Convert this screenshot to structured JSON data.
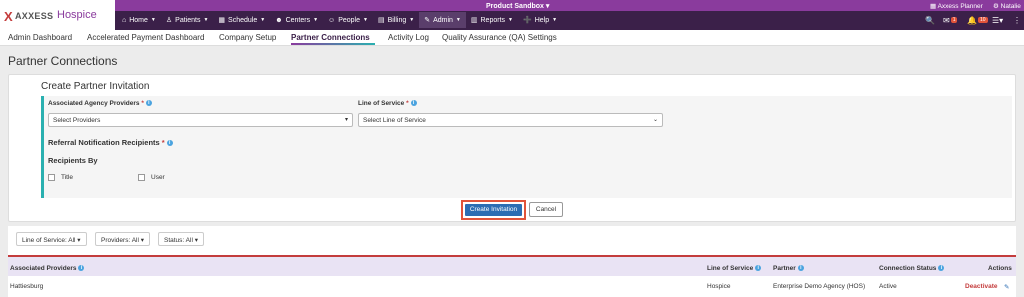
{
  "topbar": {
    "logo": {
      "x": "X",
      "axxess": "AXXESS",
      "hospice": "Hospice"
    },
    "environment": "Product Sandbox ▾",
    "planner": "Axxess Planner",
    "user": "Natalie"
  },
  "mainnav": [
    {
      "label": "Home",
      "icon": "home-icon"
    },
    {
      "label": "Patients",
      "icon": "user-icon"
    },
    {
      "label": "Schedule",
      "icon": "calendar-icon"
    },
    {
      "label": "Centers",
      "icon": "users-icon"
    },
    {
      "label": "People",
      "icon": "people-icon"
    },
    {
      "label": "Billing",
      "icon": "billing-icon"
    },
    {
      "label": "Admin",
      "icon": "wrench-icon"
    },
    {
      "label": "Reports",
      "icon": "chart-icon"
    },
    {
      "label": "Help",
      "icon": "help-icon"
    }
  ],
  "rightnav": {
    "mail_count": "1",
    "alerts_count": "10"
  },
  "subnav": [
    "Admin Dashboard",
    "Accelerated Payment Dashboard",
    "Company Setup",
    "Partner Connections",
    "Activity Log",
    "Quality Assurance (QA) Settings"
  ],
  "page_title": "Partner Connections",
  "form": {
    "title": "Create Partner Invitation",
    "providers_label": "Associated Agency Providers",
    "providers_placeholder": "Select Providers",
    "los_label": "Line of Service",
    "los_placeholder": "Select Line of Service",
    "referral_label": "Referral Notification Recipients",
    "recipients_by": "Recipients By",
    "opt_title": "Title",
    "opt_user": "User",
    "required_mark": "*",
    "create_label": "Create Invitation",
    "cancel_label": "Cancel"
  },
  "filters": [
    "Line of Service: All ▾",
    "Providers: All ▾",
    "Status: All ▾"
  ],
  "table": {
    "headers": [
      "Associated Providers",
      "Line of Service",
      "Partner",
      "Connection Status",
      "Actions"
    ],
    "rows": [
      {
        "provider": "Hattiesburg",
        "los": "Hospice",
        "partner": "Enterprise Demo Agency (HOS)",
        "status": "Active",
        "action": "Deactivate"
      }
    ]
  }
}
